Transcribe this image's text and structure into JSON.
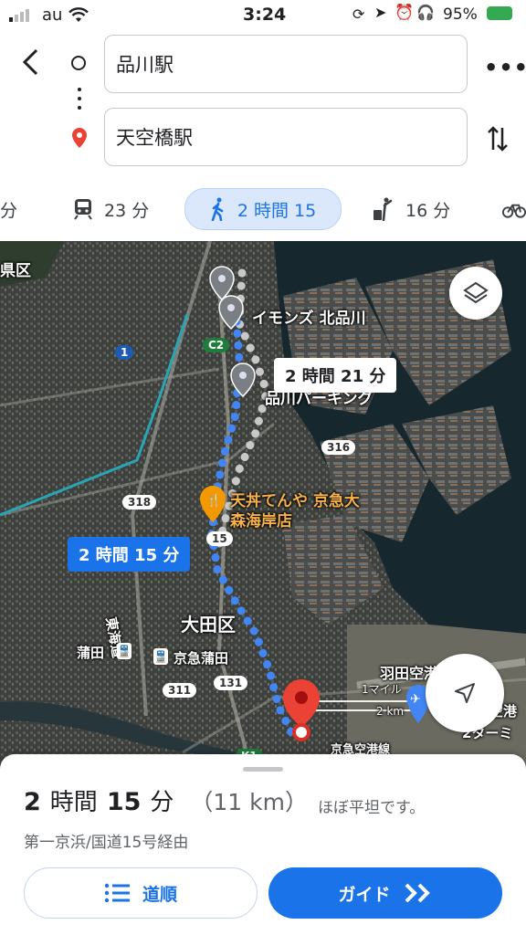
{
  "status_bar": {
    "carrier": "au",
    "time": "3:24",
    "battery": "95%"
  },
  "search": {
    "origin": "品川駅",
    "destination": "天空橋駅"
  },
  "modes": [
    {
      "id": "drive",
      "label": "分"
    },
    {
      "id": "transit",
      "label": "23 分"
    },
    {
      "id": "walk",
      "label": "2 時間 15",
      "active": true
    },
    {
      "id": "ride",
      "label": "16 分"
    },
    {
      "id": "bike",
      "label": ""
    }
  ],
  "map": {
    "callout_selected": "2 時間 15 分",
    "callout_alt": "2 時間 21 分",
    "labels": {
      "ward_top": "県区",
      "imons": "イモンズ 北品川",
      "parking": "品川パーキング",
      "tenya_1": "天丼てんや 京急大",
      "tenya_2": "森海岸店",
      "ota": "大田区",
      "kamata": "蒲田",
      "keikyu_kamata": "京急蒲田",
      "higashi_kaido": "東海道",
      "haneda": "羽田空港",
      "airport_terminal": "羽田空港",
      "terminal2": "2ターミ",
      "keikyu_line": "京急空港線",
      "scale_mile": "1マイル",
      "scale_km": "2 km"
    },
    "road_badges": [
      "C2",
      "1",
      "316",
      "318",
      "15",
      "311",
      "131",
      "K1"
    ]
  },
  "summary": {
    "duration_num1": "2",
    "duration_unit1": "時間",
    "duration_num2": "15",
    "duration_unit2": "分",
    "distance": "（11 km）",
    "note": "ほぼ平坦です。",
    "via": "第一京浜/国道15号経由"
  },
  "actions": {
    "steps_label": "道順",
    "guide_label": "ガイド"
  },
  "colors": {
    "accent": "#1a73e8",
    "route": "#4285f4",
    "pin": "#ea4335"
  }
}
